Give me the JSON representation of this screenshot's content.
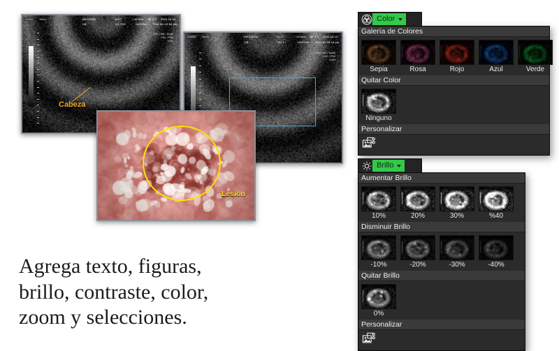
{
  "caption": {
    "line1": "Agrega texto, figuras,",
    "line2": "brillo, contraste, color,",
    "line3": "zoom y selecciones."
  },
  "images": [
    {
      "id": "ultrasound-obstetric-1",
      "annotation_label": "Cabeza",
      "annotation_color": "#f0a830",
      "overlay": "leader-line-text",
      "header": {
        "device": "MEDISON",
        "mode": "OB",
        "patient_id": "#127",
        "depth": "/ 16.0cm",
        "mi_label": "MI",
        "mi_value": "0.9",
        "date": "2002-10-10",
        "probe": "C3-7ED",
        "preset": "HARGen",
        "tis_label": "TIb",
        "tis_value": "0.1",
        "time": "01:10:54 pm",
        "gain": "[2D] G68 / 57dB",
        "fa": "FA2 / P60",
        "har": "HAR",
        "speed": "kim/s",
        "sample": "SA500"
      }
    },
    {
      "id": "ultrasound-obstetric-2",
      "annotation_label": "",
      "overlay": "selection-rectangle",
      "selection_color": "#4aa8d8",
      "header": {
        "device": "MEDISON",
        "mode": "OB",
        "patient_id": "#127",
        "depth": "/ 14.0cm",
        "mi_label": "MI",
        "mi_value": "1.3",
        "date": "2002-10-10",
        "probe": "VM-7 /",
        "preset": "HARGen",
        "tis_label": "TIb",
        "tis_value": "0.0",
        "time": "01:26:18 pm",
        "gain": "[2D] G50 / 56dB",
        "fa": "FA2 / P56",
        "har": "HAR",
        "speed": "kim/s",
        "sample": "SA500"
      }
    },
    {
      "id": "endoscopy-lesion",
      "annotation_label": "Lesión",
      "annotation_color": "#ffe000",
      "overlay": "ellipse-and-text",
      "selection_color": "#ffe000"
    }
  ],
  "panels": [
    {
      "id": "color-panel",
      "icon": "color-wheel-icon",
      "title": "Color",
      "dropdown_icon": "chevron-down-icon",
      "sections": [
        {
          "title": "Galería de Colores",
          "items": [
            {
              "label": "Sepia",
              "swatch": "#6b4226"
            },
            {
              "label": "Rosa",
              "swatch": "#7c3050"
            },
            {
              "label": "Rojo",
              "swatch": "#8a2015"
            },
            {
              "label": "Azul",
              "swatch": "#123a7a"
            },
            {
              "label": "Verde",
              "swatch": "#0d5a1e"
            }
          ]
        },
        {
          "title": "Quitar Color",
          "items": [
            {
              "label": "Ninguno",
              "swatch": "#9a9a9a"
            }
          ]
        },
        {
          "title": "Personalizar",
          "items": [],
          "custom_icon": "picture-settings-icon"
        }
      ]
    },
    {
      "id": "brightness-panel",
      "icon": "sun-brightness-icon",
      "title": "Brillo",
      "dropdown_icon": "chevron-down-icon",
      "sections": [
        {
          "title": "Aumentar Brillo",
          "items": [
            {
              "label": "10%",
              "level": 0.62
            },
            {
              "label": "20%",
              "level": 0.72
            },
            {
              "label": "30%",
              "level": 0.82
            },
            {
              "label": "%40",
              "level": 0.92
            }
          ]
        },
        {
          "title": "Disminuir Brillo",
          "items": [
            {
              "label": "-10%",
              "level": 0.42
            },
            {
              "label": "-20%",
              "level": 0.34
            },
            {
              "label": "-30%",
              "level": 0.26
            },
            {
              "label": "-40%",
              "level": 0.18
            }
          ]
        },
        {
          "title": "Quitar Brillo",
          "items": [
            {
              "label": "0%",
              "level": 0.52
            }
          ]
        },
        {
          "title": "Personalizar",
          "items": [],
          "custom_icon": "picture-settings-icon"
        }
      ]
    }
  ],
  "theme": {
    "accent_green": "#34c94a",
    "panel_bg": "#2b2b2b",
    "section_header_bg": "#3a3a3a",
    "page_bg": "#ffffff",
    "annotation_gold": "#f0a830",
    "annotation_yellow": "#ffe000",
    "selection_blue": "#4aa8d8"
  }
}
